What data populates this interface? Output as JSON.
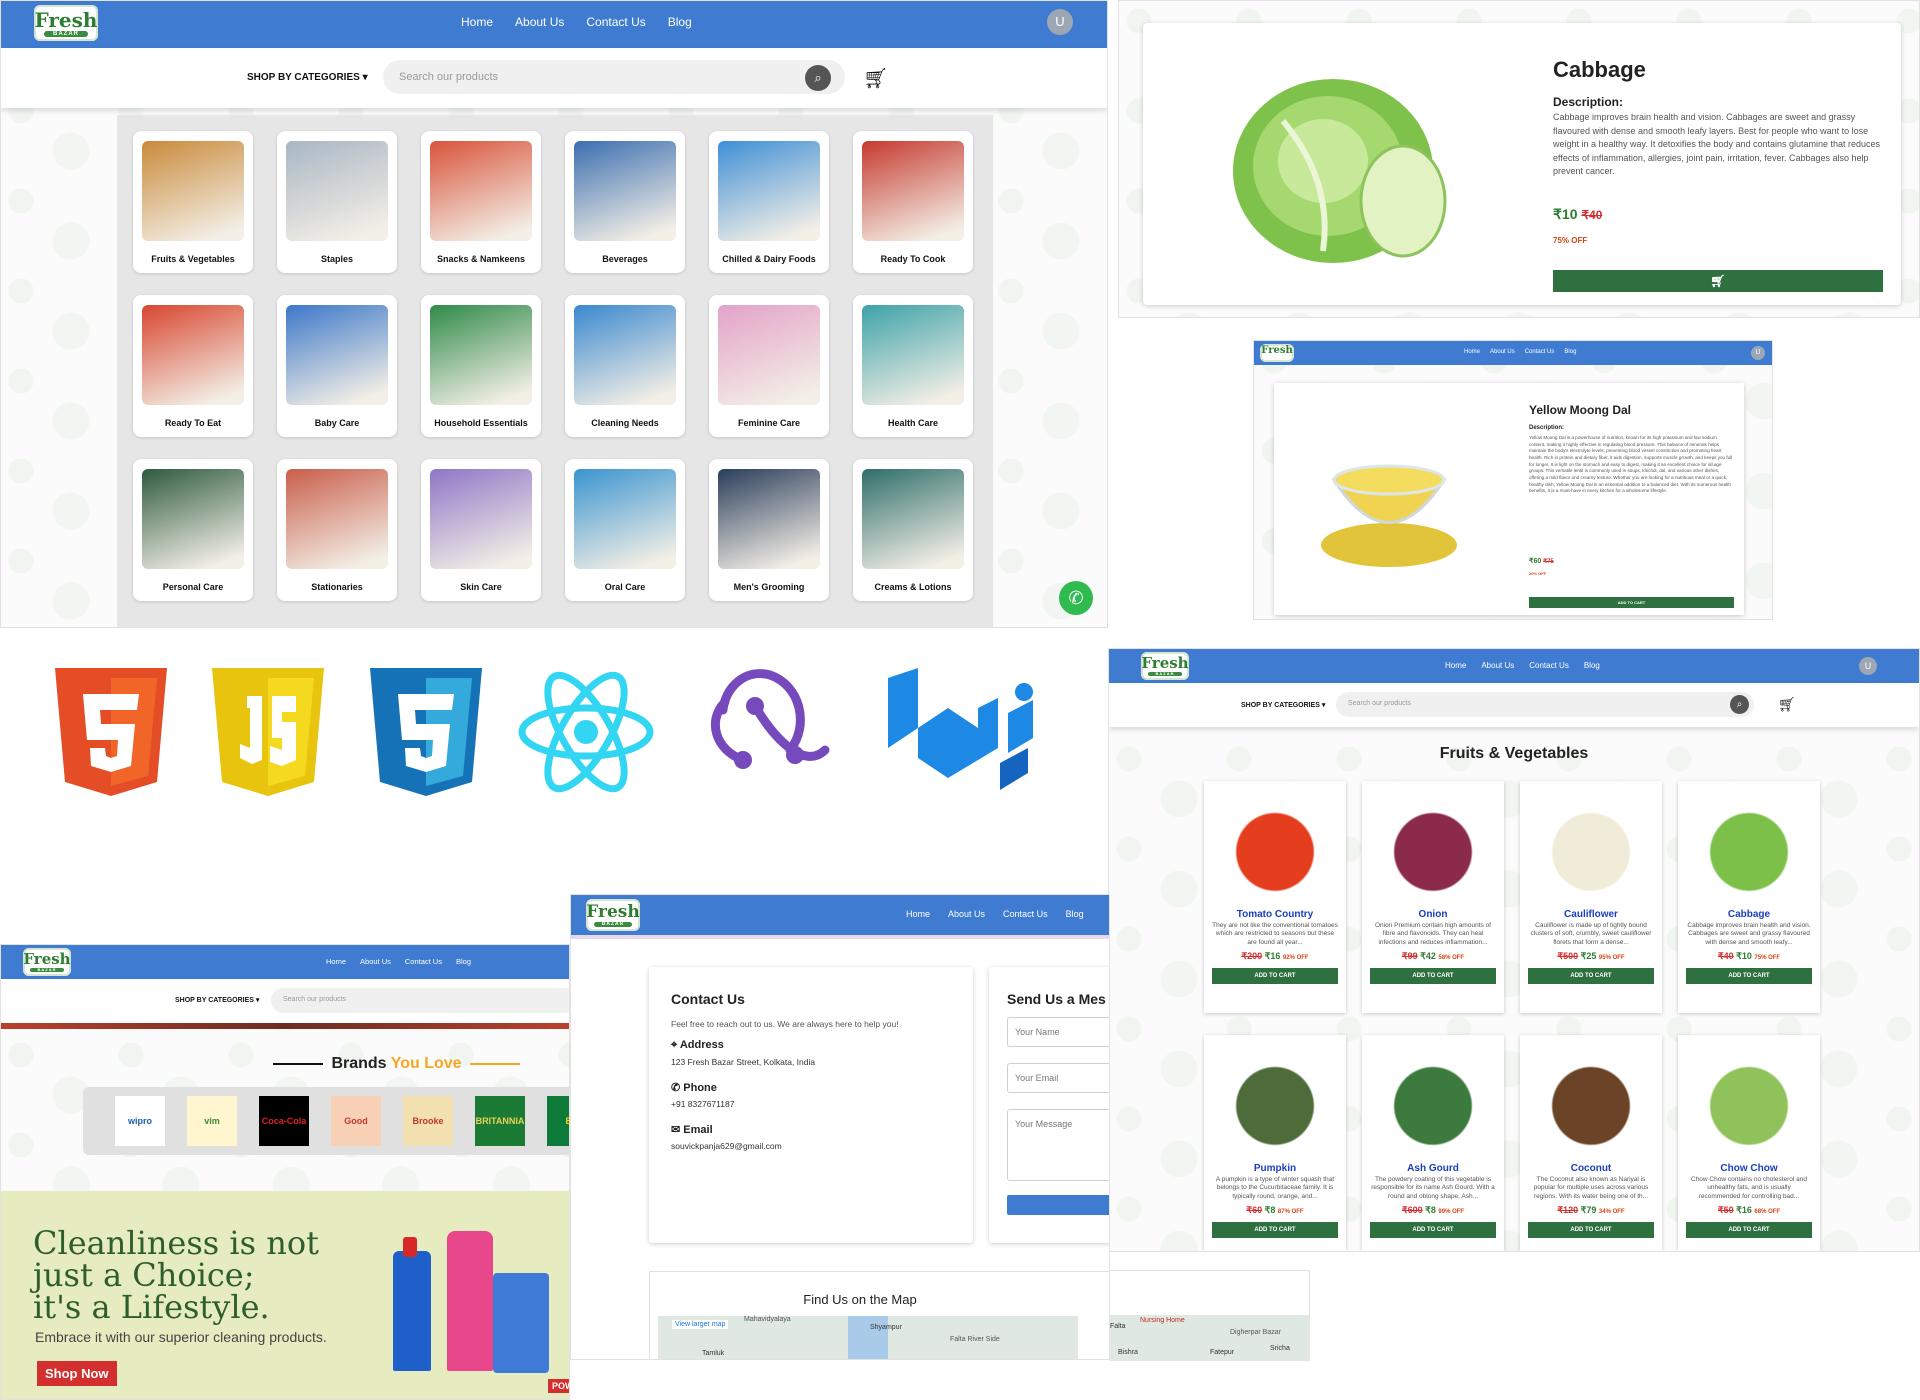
{
  "nav": {
    "logo": "Fresh",
    "logo_sub": "BAZAR",
    "home": "Home",
    "about": "About Us",
    "contact": "Contact Us",
    "blog": "Blog",
    "avatar": "U"
  },
  "subbar": {
    "shop_by_categories": "SHOP BY CATEGORIES ▾",
    "search_placeholder": "Search our products"
  },
  "categories": [
    "Fruits & Vegetables",
    "Staples",
    "Snacks & Namkeens",
    "Beverages",
    "Chilled & Dairy Foods",
    "Ready To Cook",
    "Ready To Eat",
    "Baby Care",
    "Household Essentials",
    "Cleaning Needs",
    "Feminine Care",
    "Health Care",
    "Personal Care",
    "Stationaries",
    "Skin Care",
    "Oral Care",
    "Men's Grooming",
    "Creams & Lotions"
  ],
  "cabbage_detail": {
    "title": "Cabbage",
    "desc_label": "Description:",
    "desc": "Cabbage improves brain health and vision. Cabbages are sweet and grassy flavoured with dense and smooth leafy layers. Best for people who want to lose weight in a healthy way. It detoxifies the body and contains glutamine that reduces effects of inflammation, allergies, joint pain, irritation, fever. Cabbages also help prevent cancer.",
    "price": "₹10",
    "old_price": "₹40",
    "off": "75% OFF",
    "cart_icon": "cart-icon"
  },
  "moong_detail": {
    "title": "Yellow Moong Dal",
    "desc_label": "Description:",
    "desc": "Yellow Moong Dal is a powerhouse of nutrition, known for its high potassium and low sodium content, making it highly effective in regulating blood pressure. This balance of minerals helps maintain the body's electrolyte levels, preventing blood vessel constriction and promoting heart health. Rich in protein and dietary fiber, it aids digestion, supports muscle growth, and keeps you full for longer. It is light on the stomach and easy to digest, making it an excellent choice for all age groups. This versatile lentil is commonly used in soups, khichdi, dal, and various other dishes, offering a mild flavor and creamy texture. Whether you are looking for a nutritious meal or a quick, healthy dish, Yellow Moong Dal is an essential addition to a balanced diet. With its numerous health benefits, it is a must-have in every kitchen for a wholesome lifestyle.",
    "price": "₹60",
    "old_price": "₹75",
    "off": "20% OFF",
    "button": "ADD TO CART"
  },
  "fruits_page": {
    "title": "Fruits & Vegetables",
    "add_to_cart": "ADD TO CART",
    "products": [
      {
        "name": "Tomato Country",
        "desc": "They are not like the conventional tomatoes which are restricted to seasons but these are found all year...",
        "price": "₹16",
        "old": "₹200",
        "off": "92% OFF",
        "color": "#e53e1e"
      },
      {
        "name": "Onion",
        "desc": "Onion Premium contain high amounts of fibre and flavonoids. They can heal infections and reduces inflammation...",
        "price": "₹42",
        "old": "₹99",
        "off": "58% OFF",
        "color": "#8b2a4a"
      },
      {
        "name": "Cauliflower",
        "desc": "Cauliflower is made up of tightly bound clusters of soft, crumbly, sweet cauliflower florets that form a dense...",
        "price": "₹25",
        "old": "₹500",
        "off": "95% OFF",
        "color": "#f1ecd8"
      },
      {
        "name": "Cabbage",
        "desc": "Cabbage improves brain health and vision. Cabbages are sweet and grassy flavoured with dense and smooth leafy...",
        "price": "₹10",
        "old": "₹40",
        "off": "75% OFF",
        "color": "#7cc04a"
      },
      {
        "name": "Pumpkin",
        "desc": "A pumpkin is a type of winter squash that belongs to the Cucurbitaceae family. It is typically round, orange, and...",
        "price": "₹8",
        "old": "₹60",
        "off": "87% OFF",
        "color": "#4e6b3a"
      },
      {
        "name": "Ash Gourd",
        "desc": "The powdery coating of this vegetable is responsible for its name Ash Gourd. With a round and oblong shape, Ash...",
        "price": "₹8",
        "old": "₹600",
        "off": "99% OFF",
        "color": "#3d7a3e"
      },
      {
        "name": "Coconut",
        "desc": "The Coconut also known as Nariyal is popular for multiple uses across various regions. With its water being one of th...",
        "price": "₹79",
        "old": "₹120",
        "off": "34% OFF",
        "color": "#6b4326"
      },
      {
        "name": "Chow Chow",
        "desc": "Chow Chow contains no cholesterol and unhealthy fats, and is usually recommended for controlling bad...",
        "price": "₹16",
        "old": "₹50",
        "off": "68% OFF",
        "color": "#8fc25a"
      }
    ]
  },
  "brands": {
    "title_a": "Brands",
    "title_b": "You Love",
    "items": [
      "wipro",
      "vim",
      "Coca-Cola",
      "Good knight",
      "Brooke Bond",
      "BRITANNIA",
      "BR"
    ]
  },
  "promo": {
    "line1": "Cleanliness is not",
    "line2": "just a Choice;",
    "line3": "it's a Lifestyle.",
    "sub": "Embrace it with our superior cleaning products.",
    "button": "Shop Now",
    "badge": "POWER"
  },
  "contact": {
    "title": "Contact Us",
    "intro": "Feel free to reach out to us. We are always here to help you!",
    "address_label": "Address",
    "address": "123 Fresh Bazar Street, Kolkata, India",
    "phone_label": "Phone",
    "phone": "+91 8327671187",
    "email_label": "Email",
    "email": "souvickpanja629@gmail.com",
    "form_title": "Send Us a Mes",
    "name_ph": "Your Name",
    "email_ph": "Your Email",
    "msg_ph": "Your Message",
    "map_title": "Find Us on the Map",
    "map_link": "View larger map",
    "map_places": [
      "Shyampur",
      "Falta River Side",
      "Falta",
      "Nursing Home",
      "Digherpar Bazar",
      "Tamluk",
      "Bishra",
      "Fatepur",
      "Sricha",
      "Mahavidyalaya"
    ]
  },
  "tech_icons": [
    "html5-icon",
    "javascript-icon",
    "css3-icon",
    "react-icon",
    "redux-icon",
    "mui-icon"
  ]
}
